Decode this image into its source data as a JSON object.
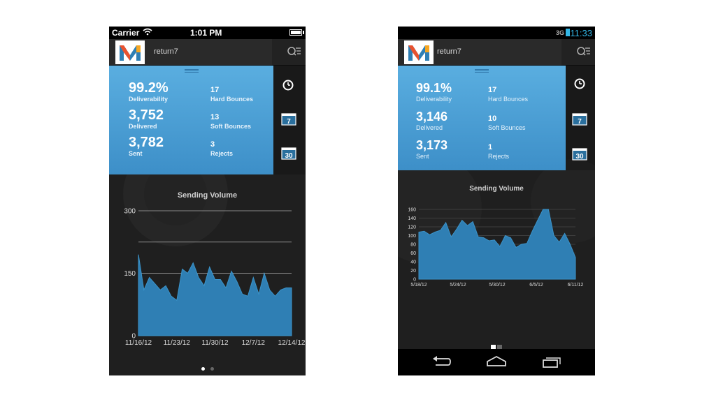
{
  "ios": {
    "status": {
      "carrier": "Carrier",
      "time": "1:01 PM"
    },
    "app_name": "return7",
    "stats": {
      "deliverability": {
        "value": "99.2%",
        "label": "Deliverability"
      },
      "delivered": {
        "value": "3,752",
        "label": "Delivered"
      },
      "sent": {
        "value": "3,782",
        "label": "Sent"
      },
      "hard_bounces": {
        "value": "17",
        "label": "Hard Bounces"
      },
      "soft_bounces": {
        "value": "13",
        "label": "Soft Bounces"
      },
      "rejects": {
        "value": "3",
        "label": "Rejects"
      }
    },
    "side_icons": {
      "week": "7",
      "month": "30"
    },
    "page_indicator": {
      "count": 2,
      "active": 0
    }
  },
  "android": {
    "status": {
      "signal": "3G",
      "time": "11:33"
    },
    "app_name": "return7",
    "stats": {
      "deliverability": {
        "value": "99.1%",
        "label": "Deliverability"
      },
      "delivered": {
        "value": "3,146",
        "label": "Delivered"
      },
      "sent": {
        "value": "3,173",
        "label": "Sent"
      },
      "hard_bounces": {
        "value": "17",
        "label": "Hard Bounces"
      },
      "soft_bounces": {
        "value": "10",
        "label": "Soft Bounces"
      },
      "rejects": {
        "value": "1",
        "label": "Rejects"
      }
    },
    "side_icons": {
      "week": "7",
      "month": "30"
    },
    "page_indicator": {
      "count": 2,
      "active": 0
    }
  },
  "colors": {
    "accent": "#4aa3dc",
    "area_fill": "#2f7fb4",
    "background": "#1f1f1f"
  },
  "chart_data": [
    {
      "type": "area",
      "title": "Sending Volume",
      "xlabel": "",
      "ylabel": "",
      "ylim": [
        0,
        300
      ],
      "yticks": [
        0,
        150,
        300
      ],
      "tick_labels": [
        "11/16/12",
        "11/23/12",
        "11/30/12",
        "12/7/12",
        "12/14/12"
      ],
      "x": [
        "11/16/12",
        "11/17/12",
        "11/18/12",
        "11/19/12",
        "11/20/12",
        "11/21/12",
        "11/22/12",
        "11/23/12",
        "11/24/12",
        "11/25/12",
        "11/26/12",
        "11/27/12",
        "11/28/12",
        "11/29/12",
        "11/30/12",
        "12/1/12",
        "12/2/12",
        "12/3/12",
        "12/4/12",
        "12/5/12",
        "12/6/12",
        "12/7/12",
        "12/8/12",
        "12/9/12",
        "12/10/12",
        "12/11/12",
        "12/12/12",
        "12/13/12",
        "12/14/12"
      ],
      "values": [
        195,
        110,
        140,
        125,
        110,
        120,
        95,
        85,
        160,
        150,
        175,
        140,
        120,
        165,
        135,
        135,
        115,
        155,
        130,
        100,
        95,
        140,
        100,
        150,
        110,
        95,
        110,
        115,
        115
      ],
      "grid": true,
      "legend": "none"
    },
    {
      "type": "area",
      "title": "Sending Volume",
      "xlabel": "",
      "ylabel": "",
      "ylim": [
        0,
        160
      ],
      "yticks": [
        0,
        20,
        40,
        60,
        80,
        100,
        120,
        140,
        160
      ],
      "tick_labels": [
        "5/18/12",
        "5/24/12",
        "5/30/12",
        "6/5/12",
        "6/11/12"
      ],
      "x": [
        "5/18/12",
        "5/19/12",
        "5/20/12",
        "5/21/12",
        "5/22/12",
        "5/23/12",
        "5/24/12",
        "5/25/12",
        "5/26/12",
        "5/27/12",
        "5/28/12",
        "5/29/12",
        "5/30/12",
        "5/31/12",
        "6/1/12",
        "6/2/12",
        "6/3/12",
        "6/4/12",
        "6/5/12",
        "6/6/12",
        "6/7/12",
        "6/8/12",
        "6/9/12",
        "6/10/12",
        "6/11/12"
      ],
      "values": [
        108,
        110,
        102,
        108,
        112,
        130,
        97,
        115,
        135,
        123,
        132,
        97,
        95,
        88,
        90,
        75,
        100,
        95,
        73,
        80,
        82,
        110,
        135,
        160,
        160,
        100,
        85,
        105,
        80,
        50
      ],
      "grid": true,
      "legend": "none"
    }
  ]
}
